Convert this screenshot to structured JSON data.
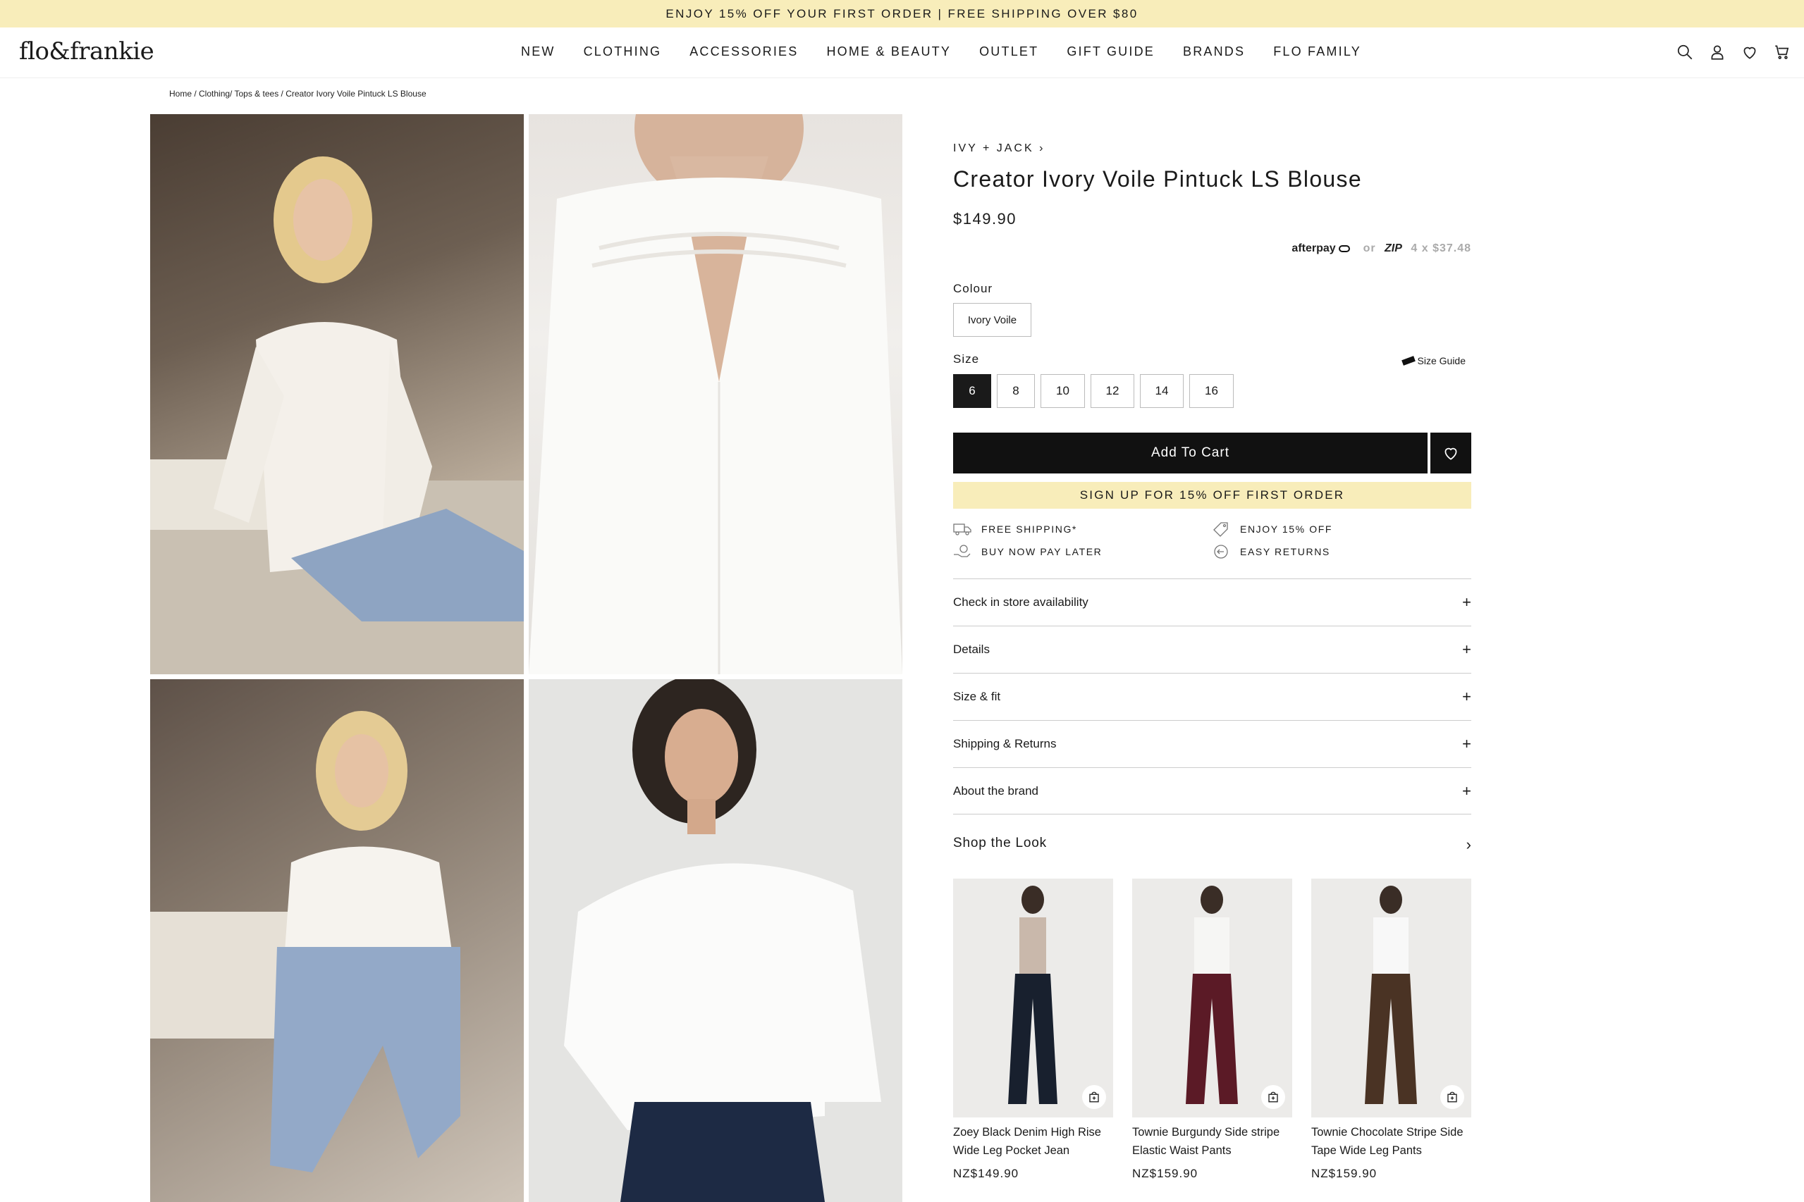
{
  "promo": {
    "text": "ENJOY 15% OFF YOUR FIRST ORDER | FREE SHIPPING OVER $80"
  },
  "header": {
    "logo": "flo&frankie",
    "nav": [
      "NEW",
      "CLOTHING",
      "ACCESSORIES",
      "HOME & BEAUTY",
      "OUTLET",
      "GIFT GUIDE",
      "BRANDS",
      "FLO FAMILY"
    ],
    "icons": [
      "search-icon",
      "account-icon",
      "wishlist-heart-icon",
      "cart-icon"
    ]
  },
  "breadcrumb": "Home / Clothing/ Tops & tees / Creator Ivory Voile Pintuck LS Blouse",
  "product": {
    "brand": "IVY + JACK ›",
    "title": "Creator Ivory Voile Pintuck LS Blouse",
    "price": "$149.90",
    "afterpay": "afterpay",
    "or": "or",
    "zip": "ZIP",
    "installments": "4 x $37.48",
    "colour_label": "Colour",
    "colour_value": "Ivory Voile",
    "size_label": "Size",
    "size_guide": "Size Guide",
    "sizes": [
      "6",
      "8",
      "10",
      "12",
      "14",
      "16"
    ],
    "selected_size": "6",
    "add_to_cart": "Add To Cart",
    "signup": "SIGN UP FOR 15% OFF FIRST ORDER",
    "features": {
      "free_shipping": "FREE SHIPPING*",
      "enjoy": "ENJOY 15% OFF",
      "bnpl": "BUY NOW PAY LATER",
      "returns": "EASY RETURNS"
    },
    "accordions": [
      "Check in store availability",
      "Details",
      "Size & fit",
      "Shipping & Returns",
      "About the brand"
    ]
  },
  "shop_the_look": {
    "title": "Shop the Look",
    "items": [
      {
        "name": "Zoey Black Denim High Rise Wide Leg Pocket Jean",
        "price": "NZ$149.90"
      },
      {
        "name": "Townie Burgundy Side stripe Elastic Waist Pants",
        "price": "NZ$159.90"
      },
      {
        "name": "Townie Chocolate Stripe Side Tape Wide Leg Pants",
        "price": "NZ$159.90"
      }
    ]
  },
  "colors": {
    "promo_bg": "#f8edba",
    "button_bg": "#111111"
  }
}
